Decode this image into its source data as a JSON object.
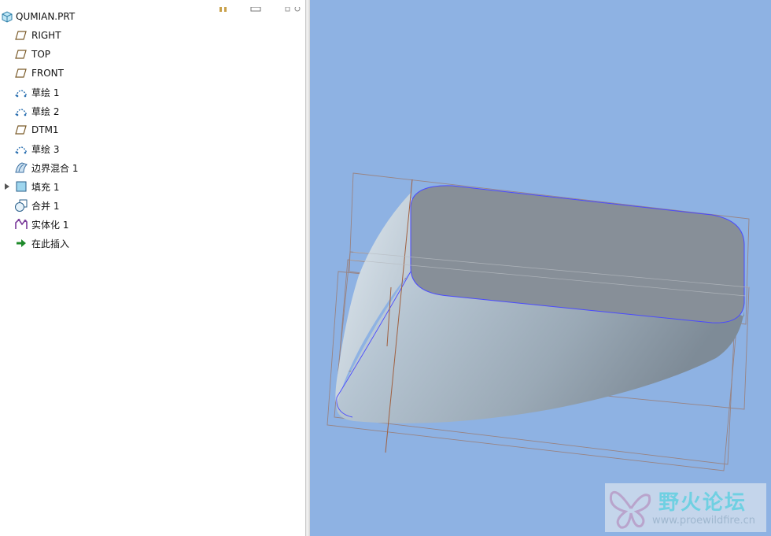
{
  "model_tree": {
    "root": {
      "label": "QUMIAN.PRT",
      "icon": "part-icon"
    },
    "items": [
      {
        "label": "RIGHT",
        "icon": "datum-plane-icon",
        "expandable": false
      },
      {
        "label": "TOP",
        "icon": "datum-plane-icon",
        "expandable": false
      },
      {
        "label": "FRONT",
        "icon": "datum-plane-icon",
        "expandable": false
      },
      {
        "label": "草绘 1",
        "icon": "sketch-icon",
        "expandable": false
      },
      {
        "label": "草绘 2",
        "icon": "sketch-icon",
        "expandable": false
      },
      {
        "label": "DTM1",
        "icon": "datum-plane-icon",
        "expandable": false
      },
      {
        "label": "草绘 3",
        "icon": "sketch-icon",
        "expandable": false
      },
      {
        "label": "边界混合 1",
        "icon": "boundary-blend-icon",
        "expandable": false
      },
      {
        "label": "填充 1",
        "icon": "fill-icon",
        "expandable": true
      },
      {
        "label": "合并 1",
        "icon": "merge-icon",
        "expandable": false
      },
      {
        "label": "实体化 1",
        "icon": "solidify-icon",
        "expandable": false
      },
      {
        "label": "在此插入",
        "icon": "insert-here-arrow-icon",
        "expandable": false
      }
    ]
  },
  "watermark": {
    "title": "野火论坛",
    "url": "www.proewildfire.cn"
  },
  "colors": {
    "viewport_bg": "#8eb2e3",
    "top_face": "#878f98",
    "datum_edge": "#a06040",
    "selection_edge": "#4a4aff"
  }
}
